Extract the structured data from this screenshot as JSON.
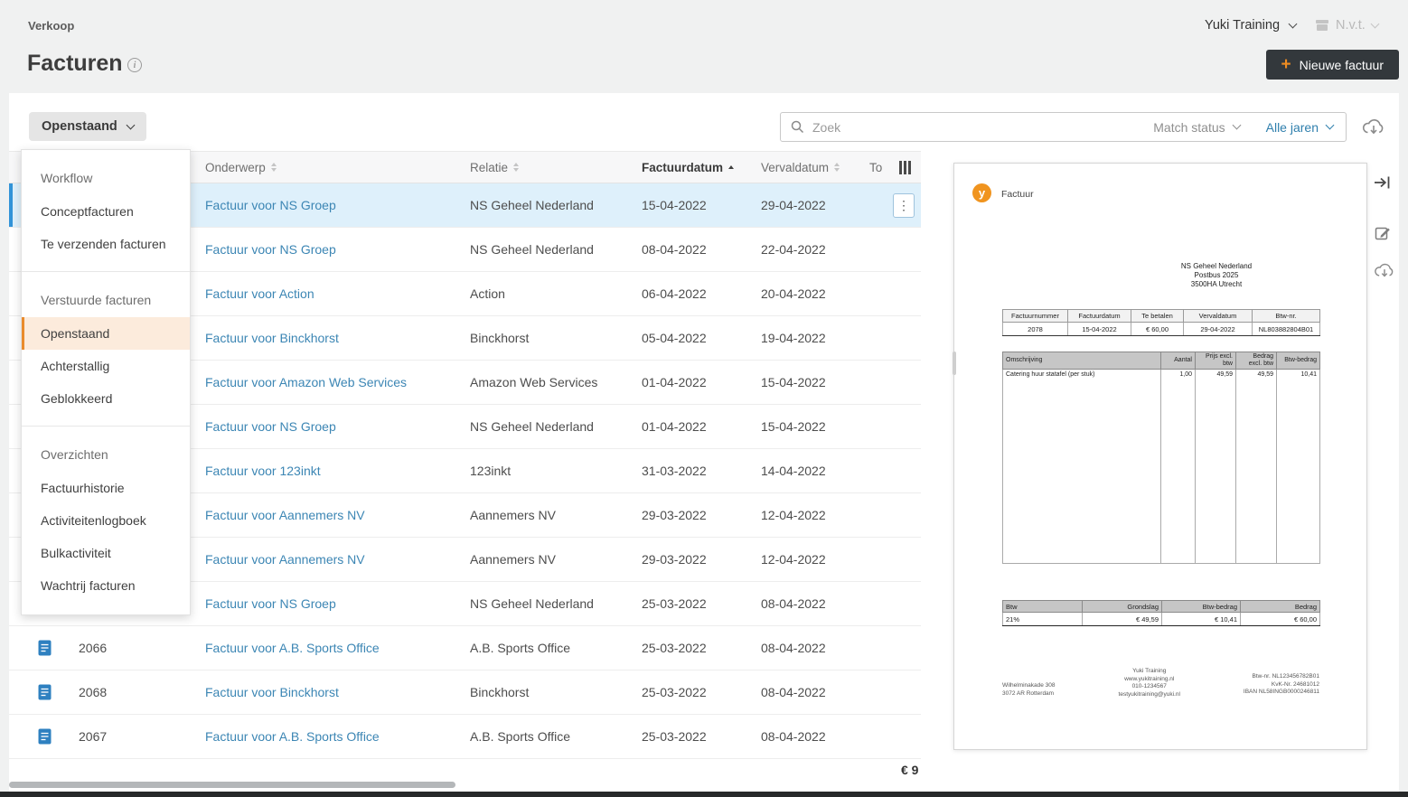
{
  "page": {
    "breadcrumb": "Verkoop",
    "title": "Facturen"
  },
  "topbar": {
    "company": "Yuki Training",
    "administration": "N.v.t.",
    "new_invoice": "Nieuwe factuur"
  },
  "toolbar": {
    "filter": "Openstaand",
    "search_placeholder": "Zoek",
    "match_status": "Match status",
    "year_filter": "Alle jaren"
  },
  "menu": {
    "selected": "Openstaand",
    "sections": [
      {
        "header": "Workflow",
        "items": [
          "Conceptfacturen",
          "Te verzenden facturen"
        ]
      },
      {
        "header": "Verstuurde facturen",
        "items": [
          "Openstaand",
          "Achterstallig",
          "Geblokkeerd"
        ]
      },
      {
        "header": "Overzichten",
        "items": [
          "Factuurhistorie",
          "Activiteitenlogboek",
          "Bulkactiviteit",
          "Wachtrij facturen"
        ]
      }
    ]
  },
  "table": {
    "columns": [
      {
        "label": "Onderwerp"
      },
      {
        "label": "Relatie"
      },
      {
        "label": "Factuurdatum",
        "sorted": "asc"
      },
      {
        "label": "Vervaldatum"
      },
      {
        "label": "To"
      }
    ],
    "rows": [
      {
        "nr": "",
        "onderwerp": "Factuur voor NS Groep",
        "relatie": "NS Geheel Nederland",
        "factuurdatum": "15-04-2022",
        "vervaldatum": "29-04-2022",
        "selected": true
      },
      {
        "nr": "",
        "onderwerp": "Factuur voor NS Groep",
        "relatie": "NS Geheel Nederland",
        "factuurdatum": "08-04-2022",
        "vervaldatum": "22-04-2022"
      },
      {
        "nr": "",
        "onderwerp": "Factuur voor Action",
        "relatie": "Action",
        "factuurdatum": "06-04-2022",
        "vervaldatum": "20-04-2022"
      },
      {
        "nr": "",
        "onderwerp": "Factuur voor Binckhorst",
        "relatie": "Binckhorst",
        "factuurdatum": "05-04-2022",
        "vervaldatum": "19-04-2022"
      },
      {
        "nr": "",
        "onderwerp": "Factuur voor Amazon Web Services",
        "relatie": "Amazon Web Services",
        "factuurdatum": "01-04-2022",
        "vervaldatum": "15-04-2022"
      },
      {
        "nr": "",
        "onderwerp": "Factuur voor NS Groep",
        "relatie": "NS Geheel Nederland",
        "factuurdatum": "01-04-2022",
        "vervaldatum": "15-04-2022"
      },
      {
        "nr": "",
        "onderwerp": "Factuur voor 123inkt",
        "relatie": "123inkt",
        "factuurdatum": "31-03-2022",
        "vervaldatum": "14-04-2022"
      },
      {
        "nr": "",
        "onderwerp": "Factuur voor Aannemers NV",
        "relatie": "Aannemers NV",
        "factuurdatum": "29-03-2022",
        "vervaldatum": "12-04-2022"
      },
      {
        "nr": "",
        "onderwerp": "Factuur voor Aannemers NV",
        "relatie": "Aannemers NV",
        "factuurdatum": "29-03-2022",
        "vervaldatum": "12-04-2022"
      },
      {
        "nr": "",
        "onderwerp": "Factuur voor NS Groep",
        "relatie": "NS Geheel Nederland",
        "factuurdatum": "25-03-2022",
        "vervaldatum": "08-04-2022"
      },
      {
        "nr": "2066",
        "onderwerp": "Factuur voor A.B. Sports Office",
        "relatie": "A.B. Sports Office",
        "factuurdatum": "25-03-2022",
        "vervaldatum": "08-04-2022",
        "doc_icon": true
      },
      {
        "nr": "2068",
        "onderwerp": "Factuur voor Binckhorst",
        "relatie": "Binckhorst",
        "factuurdatum": "25-03-2022",
        "vervaldatum": "08-04-2022",
        "doc_icon": true
      },
      {
        "nr": "2067",
        "onderwerp": "Factuur voor A.B. Sports Office",
        "relatie": "A.B. Sports Office",
        "factuurdatum": "25-03-2022",
        "vervaldatum": "08-04-2022",
        "doc_icon": true
      }
    ],
    "footer_total": "€ 9"
  },
  "preview": {
    "doc_type": "Factuur",
    "recipient": [
      "NS Geheel Nederland",
      "Postbus 2025",
      "3500HA Utrecht"
    ],
    "info": {
      "headers": [
        "Factuurnummer",
        "Factuurdatum",
        "Te betalen",
        "Vervaldatum",
        "Btw-nr."
      ],
      "values": [
        "2078",
        "15-04-2022",
        "€ 60,00",
        "29-04-2022",
        "NL803882804B01"
      ]
    },
    "lines": {
      "headers": [
        "Omschrijving",
        "Aantal",
        "Prijs excl. btw",
        "Bedrag excl. btw",
        "Btw-bedrag"
      ],
      "rows": [
        [
          "Catering huur statafel (per stuk)",
          "1,00",
          "49,59",
          "49,59",
          "10,41"
        ]
      ]
    },
    "totals": {
      "headers": [
        "Btw",
        "Grondslag",
        "Btw-bedrag",
        "Bedrag"
      ],
      "values": [
        "21%",
        "€ 49,59",
        "€ 10,41",
        "€ 60,00"
      ]
    },
    "footer": {
      "address": [
        "Wilhelminakade 308",
        "3072 AR Rotterdam"
      ],
      "company": [
        "Yuki Training",
        "www.yukitraining.nl",
        "010-1234567",
        "testyukitraining@yuki.nl"
      ],
      "registration": [
        "Btw-nr. NL123456782B01",
        "KvK-Nr. 24681012",
        "IBAN NL58INGB0000246811"
      ]
    }
  },
  "colors": {
    "accent_orange": "#ee8c22",
    "link_blue": "#3c86b4",
    "selected_row": "#def0fb",
    "button_dark": "#33383c",
    "menu_selected": "#fcebdc"
  }
}
